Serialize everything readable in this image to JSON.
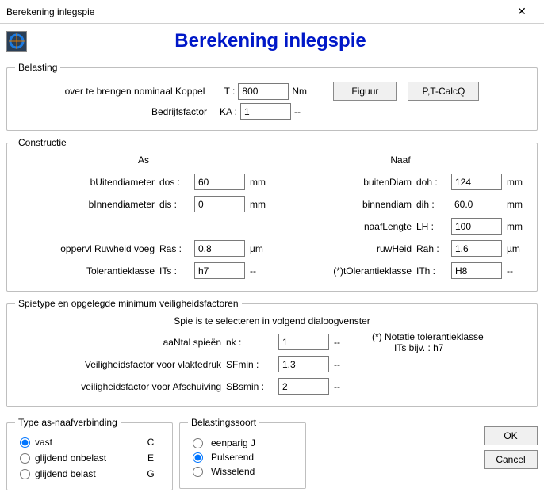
{
  "window": {
    "title": "Berekening inlegspie"
  },
  "heading": "Berekening inlegspie",
  "belasting": {
    "legend": "Belasting",
    "koppel_label": "over te brengen nominaal Koppel",
    "koppel_sym": "T   :",
    "koppel_val": "800",
    "koppel_unit": "Nm",
    "bedrijfs_label": "Bedrijfsfactor",
    "bedrijfs_sym": "KA :",
    "bedrijfs_val": "1",
    "bedrijfs_unit": "--",
    "btn_figuur": "Figuur",
    "btn_ptcalcq": "P,T-CalcQ"
  },
  "constructie": {
    "legend": "Constructie",
    "as_head": "As",
    "naaf_head": "Naaf",
    "as": {
      "buiten": {
        "lbl": "bUitendiameter",
        "sym": "dos :",
        "val": "60",
        "unit": "mm"
      },
      "binnen": {
        "lbl": "bInnendiameter",
        "sym": "dis :",
        "val": "0",
        "unit": "mm"
      },
      "ruw": {
        "lbl": "oppervl Ruwheid voeg",
        "sym": "Ras :",
        "val": "0.8",
        "unit": "µm"
      },
      "tol": {
        "lbl": "Tolerantieklasse",
        "sym": "ITs :",
        "val": "h7",
        "unit": "--"
      }
    },
    "naaf": {
      "buiten": {
        "lbl": "buitenDiam",
        "sym": "doh :",
        "val": "124",
        "unit": "mm"
      },
      "binnen": {
        "lbl": "binnendiam",
        "sym": "dih :",
        "val": "60.0",
        "unit": "mm"
      },
      "lengte": {
        "lbl": "naafLengte",
        "sym": "LH :",
        "val": "100",
        "unit": "mm"
      },
      "ruw": {
        "lbl": "ruwHeid",
        "sym": "Rah :",
        "val": "1.6",
        "unit": "µm"
      },
      "tol": {
        "lbl": "(*)tOlerantieklasse",
        "sym": "ITh :",
        "val": "H8",
        "unit": "--"
      }
    }
  },
  "spietype": {
    "legend": "Spietype en opgelegde minimum veiligheidsfactoren",
    "intro": "Spie is te selecteren in volgend dialoogvenster",
    "aantal": {
      "lbl": "aaNtal spieën",
      "sym": "nk :",
      "val": "1",
      "unit": "--"
    },
    "sfmin": {
      "lbl": "Veiligheidsfactor voor vlaktedruk",
      "sym": "SFmin :",
      "val": "1.3",
      "unit": "--"
    },
    "sbsmin": {
      "lbl": "veiligheidsfactor voor Afschuiving",
      "sym": "SBsmin :",
      "val": "2",
      "unit": "--"
    },
    "note1": "(*) Notatie tolerantieklasse",
    "note2": "ITs bijv. : h7"
  },
  "type_verbinding": {
    "legend": "Type as-naafverbinding",
    "opts": [
      {
        "label": "vast",
        "letter": "C",
        "checked": true
      },
      {
        "label": "glijdend onbelast",
        "letter": "E",
        "checked": false
      },
      {
        "label": "glijdend belast",
        "letter": "G",
        "checked": false
      }
    ]
  },
  "belastingssoort": {
    "legend": "Belastingssoort",
    "opts": [
      {
        "label": "eenparig J",
        "checked": false
      },
      {
        "label": "Pulserend",
        "checked": true
      },
      {
        "label": "Wisselend",
        "checked": false
      }
    ]
  },
  "buttons": {
    "ok": "OK",
    "cancel": "Cancel"
  }
}
